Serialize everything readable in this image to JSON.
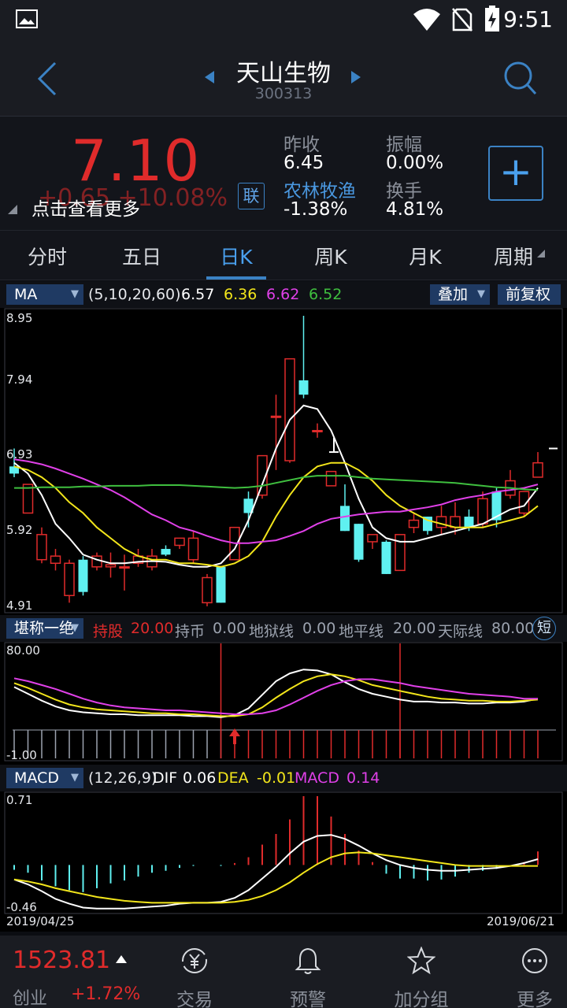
{
  "status_bar": {
    "time": "9:51"
  },
  "header": {
    "title": "天山生物",
    "code": "300313"
  },
  "quote": {
    "price": "7.10",
    "change": "+0.65 +10.08%",
    "tip": "点击查看更多",
    "lian": "联",
    "prev_close_label": "昨收",
    "prev_close": "6.45",
    "amplitude_label": "振幅",
    "amplitude": "0.00%",
    "sector_label": "农林牧渔",
    "sector_pct": "-1.38%",
    "turnover_label": "换手",
    "turnover": "4.81%"
  },
  "tabs": [
    {
      "label": "分时"
    },
    {
      "label": "五日"
    },
    {
      "label": "日K"
    },
    {
      "label": "周K"
    },
    {
      "label": "月K"
    },
    {
      "label": "周期"
    }
  ],
  "ma_bar": {
    "selector": "MA",
    "params": "(5,10,20,60)",
    "v5": "6.57",
    "v10": "6.36",
    "v20": "6.62",
    "v60": "6.52",
    "overlay": "叠加",
    "fq": "前复权",
    "colors": {
      "ma5": "#ffffff",
      "ma10": "#f2e51b",
      "ma20": "#e040e8",
      "ma60": "#3fbf3f"
    }
  },
  "price_axis": {
    "high": "8.95",
    "l2": "7.94",
    "l3": "6.93",
    "l4": "5.92",
    "low": "4.91"
  },
  "mid_bar": {
    "selector": "堪称一绝",
    "hold_label": "持股",
    "hold": "20.00",
    "coin_label": "持币",
    "coin": "0.00",
    "hell_label": "地狱线",
    "hell": "0.00",
    "ground_label": "地平线",
    "ground": "20.00",
    "sky_label": "天际线",
    "sky": "80.00",
    "short": "短"
  },
  "mid_axis": {
    "top": "80.00",
    "bottom": "-1.00"
  },
  "macd_bar": {
    "selector": "MACD",
    "params": "(12,26,9)",
    "dif_label": "DIF",
    "dif": "0.06",
    "dea_label": "DEA",
    "dea": "-0.01",
    "macd_label": "MACD",
    "macd": "0.14"
  },
  "macd_axis": {
    "top": "0.71",
    "bottom": "-0.46"
  },
  "dates": {
    "start": "2019/04/25",
    "end": "2019/06/21"
  },
  "bottom_bar": {
    "index_value": "1523.81",
    "index_name": "创业",
    "index_pct": "+1.72%",
    "nav": [
      {
        "label": "交易",
        "icon": "yen-exchange-icon"
      },
      {
        "label": "预警",
        "icon": "bell-icon"
      },
      {
        "label": "加分组",
        "icon": "star-icon"
      },
      {
        "label": "更多",
        "icon": "more-icon"
      }
    ]
  },
  "chart_data": {
    "type": "candlestick",
    "y_range": [
      4.91,
      8.95
    ],
    "candles": [
      {
        "o": 6.85,
        "c": 6.75,
        "h": 7.1,
        "l": 6.7
      },
      {
        "o": 6.2,
        "c": 6.6,
        "h": 6.6,
        "l": 6.2
      },
      {
        "o": 5.55,
        "c": 5.9,
        "h": 6.0,
        "l": 5.5
      },
      {
        "o": 5.5,
        "c": 5.6,
        "h": 5.7,
        "l": 5.4
      },
      {
        "o": 5.05,
        "c": 5.5,
        "h": 5.55,
        "l": 4.95
      },
      {
        "o": 5.55,
        "c": 5.1,
        "h": 5.6,
        "l": 5.05
      },
      {
        "o": 5.45,
        "c": 5.6,
        "h": 5.65,
        "l": 5.4
      },
      {
        "o": 5.45,
        "c": 5.48,
        "h": 5.65,
        "l": 5.3
      },
      {
        "o": 5.45,
        "c": 5.45,
        "h": 5.62,
        "l": 5.12
      },
      {
        "o": 5.5,
        "c": 5.6,
        "h": 5.7,
        "l": 5.45
      },
      {
        "o": 5.45,
        "c": 5.6,
        "h": 5.7,
        "l": 5.4
      },
      {
        "o": 5.7,
        "c": 5.62,
        "h": 5.75,
        "l": 5.6
      },
      {
        "o": 5.75,
        "c": 5.85,
        "h": 5.85,
        "l": 5.7
      },
      {
        "o": 5.55,
        "c": 5.85,
        "h": 5.95,
        "l": 5.5
      },
      {
        "o": 4.95,
        "c": 5.3,
        "h": 5.35,
        "l": 4.9
      },
      {
        "o": 5.45,
        "c": 4.95,
        "h": 5.45,
        "l": 4.95
      },
      {
        "o": 5.55,
        "c": 6.0,
        "h": 6.0,
        "l": 5.55
      },
      {
        "o": 6.4,
        "c": 6.2,
        "h": 6.5,
        "l": 6.0
      },
      {
        "o": 6.45,
        "c": 7.0,
        "h": 7.0,
        "l": 6.4
      },
      {
        "o": 7.55,
        "c": 7.55,
        "h": 7.85,
        "l": 6.8
      },
      {
        "o": 6.93,
        "c": 8.35,
        "h": 8.35,
        "l": 6.9
      },
      {
        "o": 8.05,
        "c": 7.85,
        "h": 8.95,
        "l": 7.8
      },
      {
        "o": 7.35,
        "c": 7.35,
        "h": 7.45,
        "l": 7.25
      },
      {
        "o": 6.58,
        "c": 6.78,
        "h": 6.78,
        "l": 6.58
      },
      {
        "o": 6.3,
        "c": 5.95,
        "h": 6.6,
        "l": 5.95
      },
      {
        "o": 6.05,
        "c": 5.55,
        "h": 6.05,
        "l": 5.52
      },
      {
        "o": 5.8,
        "c": 5.9,
        "h": 5.9,
        "l": 5.7
      },
      {
        "o": 5.8,
        "c": 5.35,
        "h": 5.82,
        "l": 5.35
      },
      {
        "o": 5.4,
        "c": 5.9,
        "h": 5.9,
        "l": 5.4
      },
      {
        "o": 6.0,
        "c": 6.1,
        "h": 6.2,
        "l": 5.92
      },
      {
        "o": 6.15,
        "c": 5.95,
        "h": 6.15,
        "l": 5.9
      },
      {
        "o": 6.0,
        "c": 6.15,
        "h": 6.3,
        "l": 5.9
      },
      {
        "o": 6.0,
        "c": 6.15,
        "h": 6.35,
        "l": 5.9
      },
      {
        "o": 6.15,
        "c": 6.0,
        "h": 6.25,
        "l": 5.95
      },
      {
        "o": 6.05,
        "c": 6.4,
        "h": 6.5,
        "l": 6.0
      },
      {
        "o": 6.5,
        "c": 6.1,
        "h": 6.55,
        "l": 6.0
      },
      {
        "o": 6.45,
        "c": 6.65,
        "h": 6.8,
        "l": 6.4
      },
      {
        "o": 6.2,
        "c": 6.5,
        "h": 6.5,
        "l": 6.15
      },
      {
        "o": 6.7,
        "c": 6.9,
        "h": 7.05,
        "l": 6.7
      }
    ],
    "ma5": [
      6.9,
      6.75,
      6.45,
      6.05,
      5.85,
      5.62,
      5.55,
      5.5,
      5.5,
      5.52,
      5.53,
      5.52,
      5.48,
      5.45,
      5.45,
      5.5,
      5.7,
      6.1,
      6.6,
      7.1,
      7.5,
      7.7,
      7.65,
      7.35,
      6.9,
      6.4,
      6.0,
      5.85,
      5.8,
      5.8,
      5.85,
      5.9,
      5.95,
      6.0,
      6.05,
      6.15,
      6.25,
      6.3,
      6.55
    ],
    "ma10": [
      6.85,
      6.8,
      6.7,
      6.55,
      6.35,
      6.2,
      6.0,
      5.85,
      5.7,
      5.6,
      5.55,
      5.55,
      5.5,
      5.5,
      5.48,
      5.45,
      5.5,
      5.6,
      5.8,
      6.15,
      6.45,
      6.7,
      6.85,
      6.9,
      6.9,
      6.8,
      6.65,
      6.45,
      6.3,
      6.2,
      6.1,
      6.05,
      6.0,
      6.0,
      6.0,
      6.05,
      6.1,
      6.15,
      6.3
    ],
    "ma20": [
      6.95,
      6.92,
      6.88,
      6.82,
      6.75,
      6.68,
      6.6,
      6.52,
      6.42,
      6.3,
      6.18,
      6.1,
      6.0,
      5.95,
      5.88,
      5.82,
      5.78,
      5.78,
      5.8,
      5.82,
      5.88,
      5.95,
      6.05,
      6.12,
      6.15,
      6.18,
      6.2,
      6.22,
      6.22,
      6.25,
      6.28,
      6.32,
      6.38,
      6.42,
      6.45,
      6.5,
      6.52,
      6.55,
      6.6
    ],
    "ma60": [
      6.55,
      6.55,
      6.56,
      6.56,
      6.56,
      6.57,
      6.57,
      6.58,
      6.58,
      6.58,
      6.59,
      6.59,
      6.59,
      6.58,
      6.57,
      6.56,
      6.55,
      6.56,
      6.58,
      6.62,
      6.66,
      6.7,
      6.72,
      6.72,
      6.72,
      6.7,
      6.68,
      6.67,
      6.66,
      6.65,
      6.64,
      6.63,
      6.62,
      6.6,
      6.58,
      6.56,
      6.55,
      6.53,
      6.52
    ],
    "indicator": {
      "y_range": [
        -1.0,
        80.0
      ],
      "white": [
        40,
        33,
        26,
        20,
        16,
        14,
        13,
        12,
        12,
        11,
        11,
        11,
        11,
        10,
        10,
        9,
        11,
        18,
        32,
        46,
        54,
        58,
        57,
        53,
        45,
        38,
        33,
        30,
        27,
        25,
        25,
        24,
        24,
        23,
        23,
        24,
        24,
        25,
        28
      ],
      "yellow": [
        44,
        39,
        33,
        27,
        22,
        19,
        17,
        16,
        15,
        14,
        13,
        13,
        12,
        12,
        11,
        10,
        10,
        12,
        19,
        29,
        38,
        46,
        51,
        53,
        51,
        47,
        42,
        39,
        36,
        33,
        30,
        28,
        27,
        26,
        26,
        25,
        25,
        26,
        27
      ],
      "magenta": [
        49,
        46,
        42,
        38,
        33,
        28,
        24,
        21,
        19,
        18,
        17,
        16,
        16,
        15,
        14,
        13,
        12,
        12,
        13,
        16,
        22,
        29,
        36,
        42,
        46,
        48,
        48,
        46,
        44,
        41,
        39,
        37,
        35,
        33,
        32,
        31,
        30,
        28,
        28
      ],
      "hold_flags": [
        0,
        0,
        0,
        0,
        0,
        0,
        0,
        0,
        0,
        0,
        0,
        0,
        0,
        0,
        0,
        0,
        1,
        1,
        1,
        1,
        1,
        1,
        1,
        1,
        1,
        1,
        1,
        1,
        1,
        1,
        1,
        1,
        1,
        1,
        1,
        1,
        1,
        1,
        1
      ],
      "signal_lines": [
        15,
        28
      ],
      "buy_marker": 16
    },
    "macd": {
      "y_range": [
        -0.46,
        0.71
      ],
      "dif": [
        -0.15,
        -0.2,
        -0.27,
        -0.35,
        -0.4,
        -0.44,
        -0.45,
        -0.45,
        -0.45,
        -0.44,
        -0.43,
        -0.42,
        -0.4,
        -0.39,
        -0.39,
        -0.38,
        -0.34,
        -0.26,
        -0.14,
        -0.02,
        0.12,
        0.24,
        0.3,
        0.31,
        0.27,
        0.2,
        0.12,
        0.05,
        0.0,
        -0.03,
        -0.05,
        -0.06,
        -0.06,
        -0.05,
        -0.04,
        -0.03,
        -0.01,
        0.02,
        0.06
      ],
      "dea": [
        -0.15,
        -0.17,
        -0.2,
        -0.24,
        -0.27,
        -0.3,
        -0.33,
        -0.35,
        -0.37,
        -0.38,
        -0.39,
        -0.39,
        -0.39,
        -0.39,
        -0.39,
        -0.39,
        -0.38,
        -0.36,
        -0.32,
        -0.26,
        -0.18,
        -0.08,
        0.01,
        0.08,
        0.12,
        0.13,
        0.12,
        0.1,
        0.08,
        0.06,
        0.04,
        0.02,
        0.0,
        -0.01,
        -0.01,
        -0.01,
        -0.01,
        -0.01,
        -0.01
      ],
      "hist": [
        -0.05,
        -0.08,
        -0.16,
        -0.22,
        -0.26,
        -0.28,
        -0.24,
        -0.19,
        -0.16,
        -0.12,
        -0.08,
        -0.06,
        -0.03,
        -0.01,
        0.0,
        -0.01,
        0.02,
        0.08,
        0.21,
        0.32,
        0.47,
        0.71,
        0.71,
        0.5,
        0.32,
        0.15,
        0.03,
        -0.09,
        -0.14,
        -0.14,
        -0.16,
        -0.15,
        -0.12,
        -0.08,
        -0.06,
        -0.04,
        0.0,
        0.03,
        0.14
      ]
    }
  }
}
